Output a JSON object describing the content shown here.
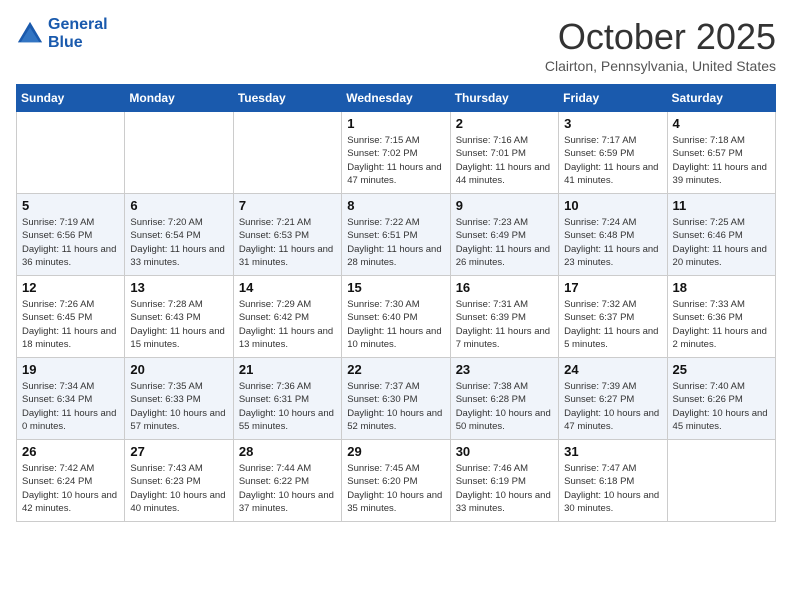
{
  "logo": {
    "line1": "General",
    "line2": "Blue"
  },
  "title": "October 2025",
  "location": "Clairton, Pennsylvania, United States",
  "days_of_week": [
    "Sunday",
    "Monday",
    "Tuesday",
    "Wednesday",
    "Thursday",
    "Friday",
    "Saturday"
  ],
  "weeks": [
    [
      {
        "day": "",
        "content": ""
      },
      {
        "day": "",
        "content": ""
      },
      {
        "day": "",
        "content": ""
      },
      {
        "day": "1",
        "content": "Sunrise: 7:15 AM\nSunset: 7:02 PM\nDaylight: 11 hours\nand 47 minutes."
      },
      {
        "day": "2",
        "content": "Sunrise: 7:16 AM\nSunset: 7:01 PM\nDaylight: 11 hours\nand 44 minutes."
      },
      {
        "day": "3",
        "content": "Sunrise: 7:17 AM\nSunset: 6:59 PM\nDaylight: 11 hours\nand 41 minutes."
      },
      {
        "day": "4",
        "content": "Sunrise: 7:18 AM\nSunset: 6:57 PM\nDaylight: 11 hours\nand 39 minutes."
      }
    ],
    [
      {
        "day": "5",
        "content": "Sunrise: 7:19 AM\nSunset: 6:56 PM\nDaylight: 11 hours\nand 36 minutes."
      },
      {
        "day": "6",
        "content": "Sunrise: 7:20 AM\nSunset: 6:54 PM\nDaylight: 11 hours\nand 33 minutes."
      },
      {
        "day": "7",
        "content": "Sunrise: 7:21 AM\nSunset: 6:53 PM\nDaylight: 11 hours\nand 31 minutes."
      },
      {
        "day": "8",
        "content": "Sunrise: 7:22 AM\nSunset: 6:51 PM\nDaylight: 11 hours\nand 28 minutes."
      },
      {
        "day": "9",
        "content": "Sunrise: 7:23 AM\nSunset: 6:49 PM\nDaylight: 11 hours\nand 26 minutes."
      },
      {
        "day": "10",
        "content": "Sunrise: 7:24 AM\nSunset: 6:48 PM\nDaylight: 11 hours\nand 23 minutes."
      },
      {
        "day": "11",
        "content": "Sunrise: 7:25 AM\nSunset: 6:46 PM\nDaylight: 11 hours\nand 20 minutes."
      }
    ],
    [
      {
        "day": "12",
        "content": "Sunrise: 7:26 AM\nSunset: 6:45 PM\nDaylight: 11 hours\nand 18 minutes."
      },
      {
        "day": "13",
        "content": "Sunrise: 7:28 AM\nSunset: 6:43 PM\nDaylight: 11 hours\nand 15 minutes."
      },
      {
        "day": "14",
        "content": "Sunrise: 7:29 AM\nSunset: 6:42 PM\nDaylight: 11 hours\nand 13 minutes."
      },
      {
        "day": "15",
        "content": "Sunrise: 7:30 AM\nSunset: 6:40 PM\nDaylight: 11 hours\nand 10 minutes."
      },
      {
        "day": "16",
        "content": "Sunrise: 7:31 AM\nSunset: 6:39 PM\nDaylight: 11 hours\nand 7 minutes."
      },
      {
        "day": "17",
        "content": "Sunrise: 7:32 AM\nSunset: 6:37 PM\nDaylight: 11 hours\nand 5 minutes."
      },
      {
        "day": "18",
        "content": "Sunrise: 7:33 AM\nSunset: 6:36 PM\nDaylight: 11 hours\nand 2 minutes."
      }
    ],
    [
      {
        "day": "19",
        "content": "Sunrise: 7:34 AM\nSunset: 6:34 PM\nDaylight: 11 hours\nand 0 minutes."
      },
      {
        "day": "20",
        "content": "Sunrise: 7:35 AM\nSunset: 6:33 PM\nDaylight: 10 hours\nand 57 minutes."
      },
      {
        "day": "21",
        "content": "Sunrise: 7:36 AM\nSunset: 6:31 PM\nDaylight: 10 hours\nand 55 minutes."
      },
      {
        "day": "22",
        "content": "Sunrise: 7:37 AM\nSunset: 6:30 PM\nDaylight: 10 hours\nand 52 minutes."
      },
      {
        "day": "23",
        "content": "Sunrise: 7:38 AM\nSunset: 6:28 PM\nDaylight: 10 hours\nand 50 minutes."
      },
      {
        "day": "24",
        "content": "Sunrise: 7:39 AM\nSunset: 6:27 PM\nDaylight: 10 hours\nand 47 minutes."
      },
      {
        "day": "25",
        "content": "Sunrise: 7:40 AM\nSunset: 6:26 PM\nDaylight: 10 hours\nand 45 minutes."
      }
    ],
    [
      {
        "day": "26",
        "content": "Sunrise: 7:42 AM\nSunset: 6:24 PM\nDaylight: 10 hours\nand 42 minutes."
      },
      {
        "day": "27",
        "content": "Sunrise: 7:43 AM\nSunset: 6:23 PM\nDaylight: 10 hours\nand 40 minutes."
      },
      {
        "day": "28",
        "content": "Sunrise: 7:44 AM\nSunset: 6:22 PM\nDaylight: 10 hours\nand 37 minutes."
      },
      {
        "day": "29",
        "content": "Sunrise: 7:45 AM\nSunset: 6:20 PM\nDaylight: 10 hours\nand 35 minutes."
      },
      {
        "day": "30",
        "content": "Sunrise: 7:46 AM\nSunset: 6:19 PM\nDaylight: 10 hours\nand 33 minutes."
      },
      {
        "day": "31",
        "content": "Sunrise: 7:47 AM\nSunset: 6:18 PM\nDaylight: 10 hours\nand 30 minutes."
      },
      {
        "day": "",
        "content": ""
      }
    ]
  ]
}
